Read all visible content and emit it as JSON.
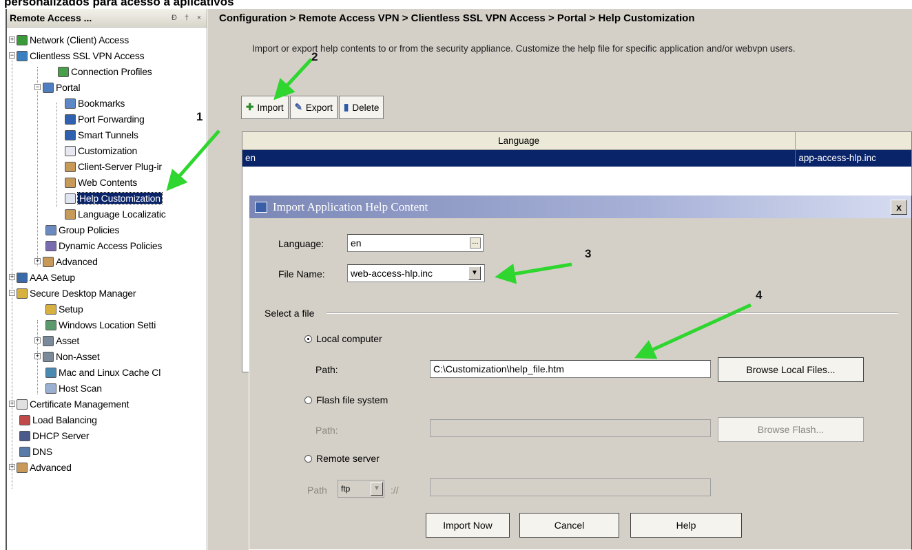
{
  "caption": "personalizados para acesso a aplicativos",
  "nav": {
    "title": "Remote Access ...",
    "header_buttons": [
      "Ð",
      "†",
      "×"
    ],
    "items": [
      "Network (Client) Access",
      "Clientless SSL VPN Access",
      "Connection Profiles",
      "Portal",
      "Bookmarks",
      "Port Forwarding",
      "Smart Tunnels",
      "Customization",
      "Client-Server Plug-ir",
      "Web Contents",
      "Help Customization",
      "Language Localizatic",
      "Group Policies",
      "Dynamic Access Policies",
      "Advanced",
      "AAA Setup",
      "Secure Desktop Manager",
      "Setup",
      "Windows Location Setti",
      "Asset",
      "Non-Asset",
      "Mac and Linux Cache Cl",
      "Host Scan",
      "Certificate Management",
      "Load Balancing",
      "DHCP Server",
      "DNS",
      "Advanced"
    ]
  },
  "config": {
    "breadcrumb": "Configuration > Remote Access VPN > Clientless SSL VPN Access > Portal > Help Customization",
    "description": "Import or export help contents to or from the security appliance. Customize the help file for specific application and/or webvpn users.",
    "toolbar": {
      "import": "Import",
      "export": "Export",
      "delete": "Delete"
    },
    "table": {
      "columns": [
        "Language",
        ""
      ],
      "rows": [
        {
          "language": "en",
          "file": "app-access-hlp.inc"
        }
      ]
    }
  },
  "dialog": {
    "title": "Import Application Help Content",
    "close": "x",
    "language_label": "Language:",
    "language_value": "en",
    "filename_label": "File Name:",
    "filename_value": "web-access-hlp.inc",
    "select_file_label": "Select a file",
    "local_label": "Local computer",
    "local_path_label": "Path:",
    "local_path_value": "C:\\Customization\\help_file.htm",
    "browse_local": "Browse Local Files...",
    "flash_label": "Flash file system",
    "flash_path_label": "Path:",
    "browse_flash": "Browse Flash...",
    "remote_label": "Remote server",
    "remote_path_label": "Path",
    "remote_protocol": "ftp",
    "remote_sep": "://",
    "import_now": "Import Now",
    "cancel": "Cancel",
    "help": "Help"
  },
  "annotations": {
    "m1": "1",
    "m2": "2",
    "m3": "3",
    "m4": "4"
  },
  "colors": {
    "arrow": "#2fd62f",
    "selection": "#0a246a",
    "dialog_bg": "#d4d0c8"
  }
}
